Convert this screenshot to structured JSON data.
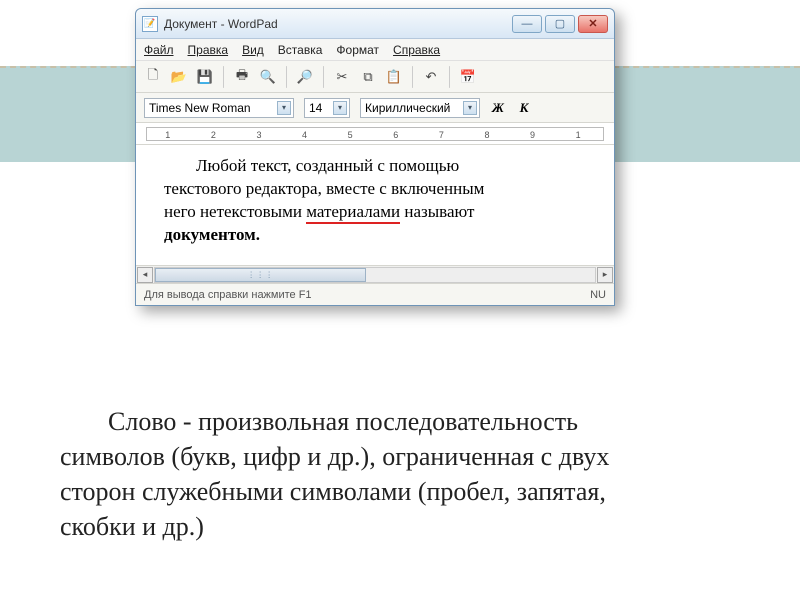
{
  "window": {
    "title": "Документ - WordPad",
    "buttons": {
      "min": "—",
      "max": "▢",
      "close": "✕"
    }
  },
  "menu": {
    "file": "Файл",
    "edit": "Правка",
    "view": "Вид",
    "insert": "Вставка",
    "format": "Формат",
    "help": "Справка"
  },
  "toolbar_icons": {
    "new": "🗋",
    "open": "📂",
    "save": "💾",
    "print": "🖶",
    "preview": "🔍",
    "find": "🔎",
    "cut": "✂",
    "copy": "⧉",
    "paste": "📋",
    "undo": "↶",
    "datetime": "📅"
  },
  "format": {
    "font": "Times New Roman",
    "size": "14",
    "script": "Кириллический",
    "bold": "Ж",
    "italic": "К"
  },
  "ruler": {
    "nums": [
      "1",
      "2",
      "3",
      "4",
      "5",
      "6",
      "7",
      "8",
      "9",
      "1"
    ]
  },
  "document": {
    "line1a": "Любой текст, созданный с помощью",
    "line2": "текстового редактора, вместе с включенным",
    "line3a": "него нетекстовыми ",
    "line3_underlined": "материалами",
    "line3b": " называют",
    "line4_bold": "документом."
  },
  "statusbar": {
    "hint": "Для вывода справки нажмите F1",
    "indicator": "NU"
  },
  "caption": {
    "t1": "Слово - произвольная последовательность",
    "t2": "символов (букв, цифр и др.), ограниченная с двух",
    "t3": "сторон служебными символами (пробел, запятая,",
    "t4": "скобки и др.)"
  }
}
